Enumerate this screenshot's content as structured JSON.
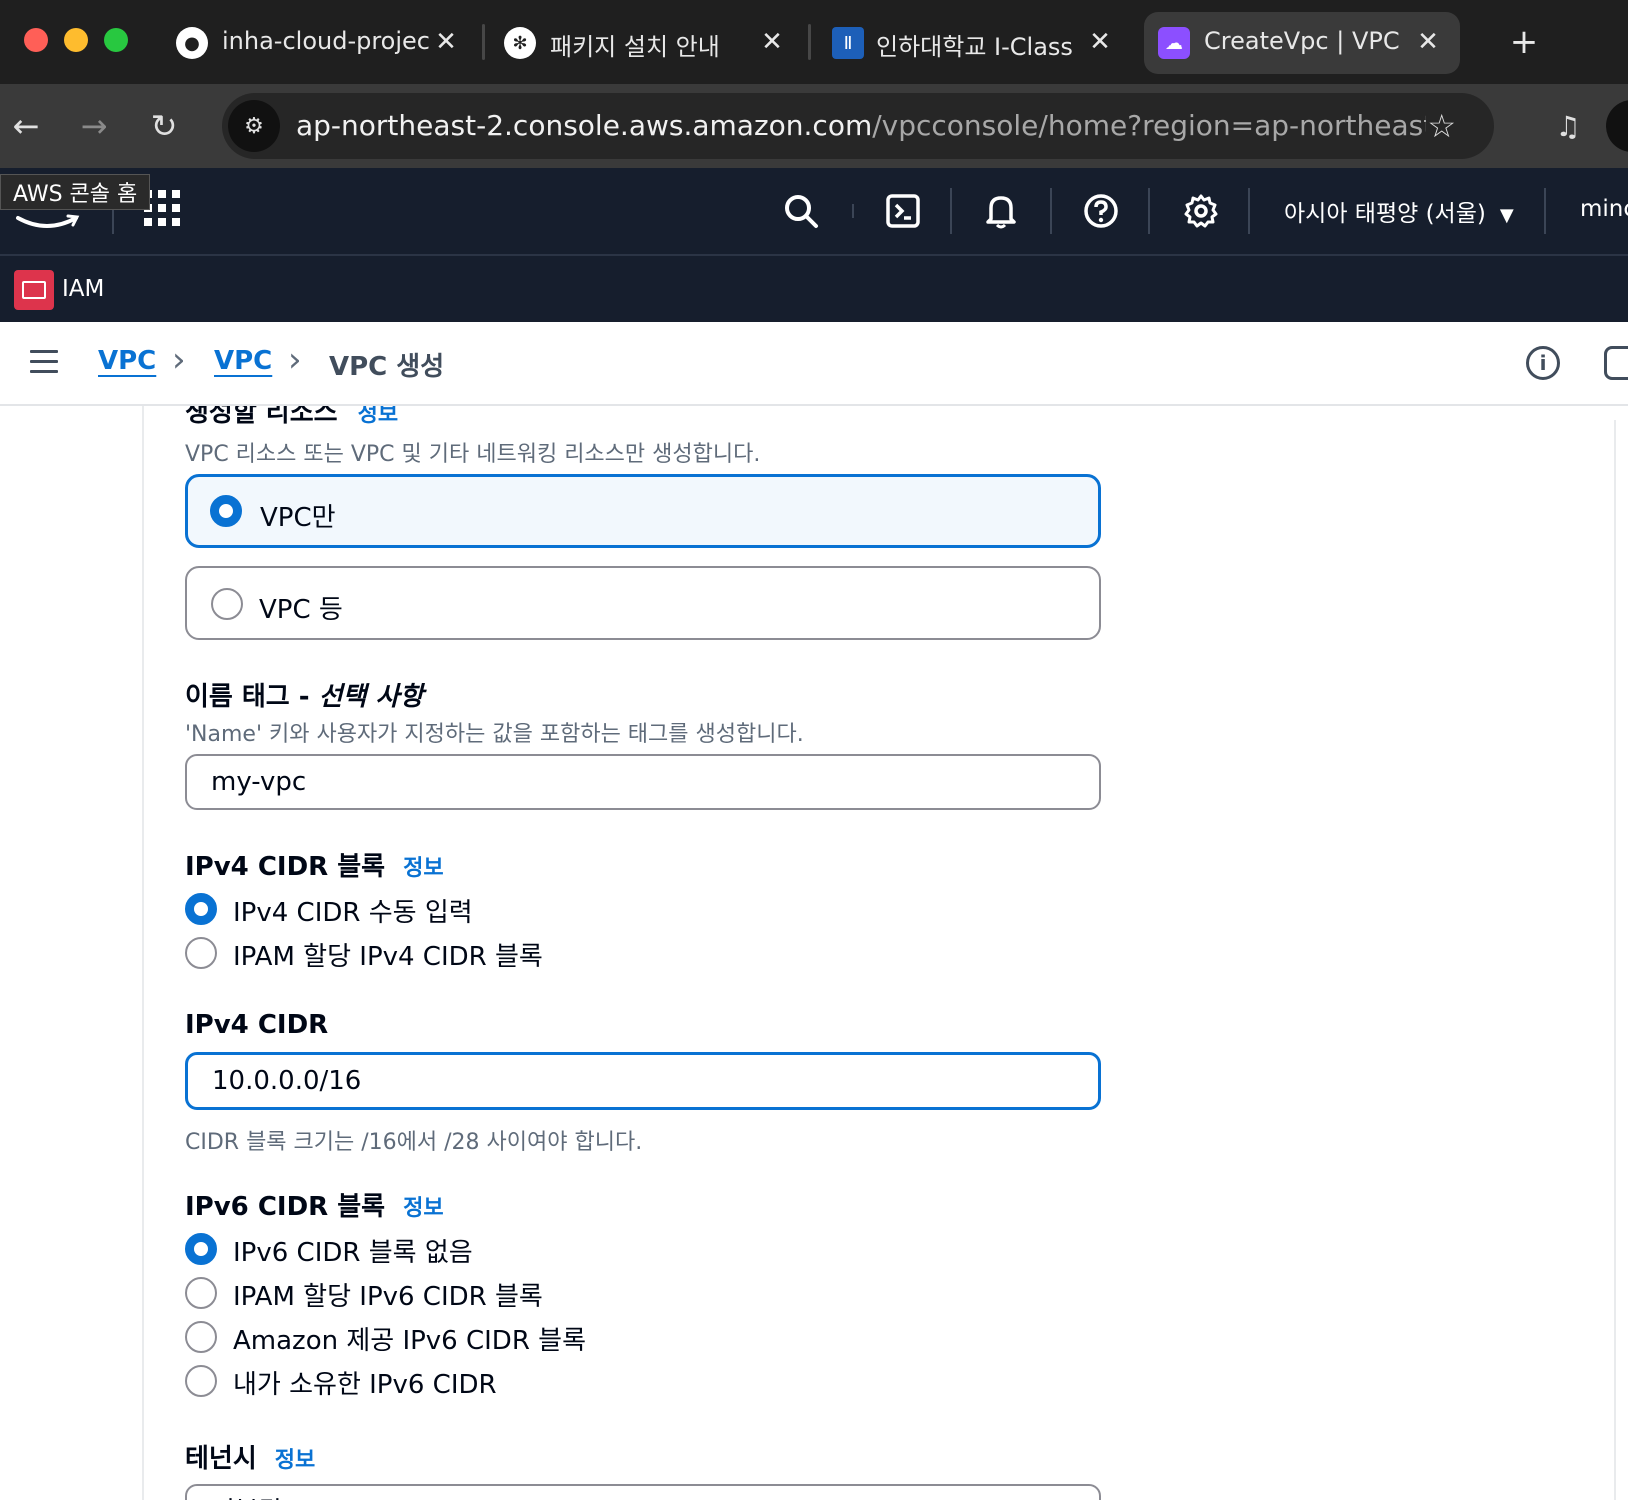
{
  "browser": {
    "tabs": [
      {
        "title": "inha-cloud-projec",
        "favicon": "github-icon"
      },
      {
        "title": "패키지 설치 안내",
        "favicon": "openai-icon"
      },
      {
        "title": "인하대학교 I-Class",
        "favicon": "iclass-icon"
      },
      {
        "title": "CreateVpc | VPC |",
        "favicon": "aws-vpc-icon",
        "active": true
      }
    ],
    "url_host": "ap-northeast-2.console.aws.amazon.com",
    "url_path": "/vpcconsole/home?region=ap-northeast-2..."
  },
  "aws_header": {
    "tooltip": "AWS 콘솔 홈",
    "region": "아시아 태평양 (서울)",
    "user": "minc",
    "service": "IAM"
  },
  "breadcrumb": {
    "items": [
      "VPC",
      "VPC"
    ],
    "current": "VPC 생성"
  },
  "form": {
    "resources_section": {
      "clipped_title": "생성할 리소스",
      "info_link": "정보",
      "description": "VPC 리소스 또는 VPC 및 기타 네트워킹 리소스만 생성합니다.",
      "options": [
        {
          "label": "VPC만",
          "selected": true
        },
        {
          "label": "VPC 등",
          "selected": false
        }
      ]
    },
    "name_tag": {
      "label": "이름 태그 - ",
      "label_optional": "선택 사항",
      "description": "'Name' 키와 사용자가 지정하는 값을 포함하는 태그를 생성합니다.",
      "value": "my-vpc"
    },
    "ipv4_block": {
      "label": "IPv4 CIDR 블록",
      "info_link": "정보",
      "options": [
        {
          "label": "IPv4 CIDR 수동 입력",
          "selected": true
        },
        {
          "label": "IPAM 할당 IPv4 CIDR 블록",
          "selected": false
        }
      ]
    },
    "ipv4_cidr": {
      "label": "IPv4 CIDR",
      "value": "10.0.0.0/16",
      "hint": "CIDR 블록 크기는 /16에서 /28 사이여야 합니다."
    },
    "ipv6_block": {
      "label": "IPv6 CIDR 블록",
      "info_link": "정보",
      "options": [
        {
          "label": "IPv6 CIDR 블록 없음",
          "selected": true
        },
        {
          "label": "IPAM 할당 IPv6 CIDR 블록",
          "selected": false
        },
        {
          "label": "Amazon 제공 IPv6 CIDR 블록",
          "selected": false
        },
        {
          "label": "내가 소유한 IPv6 CIDR",
          "selected": false
        }
      ]
    },
    "tenancy": {
      "label": "테넌시",
      "info_link": "정보",
      "value": "기본값"
    }
  },
  "colors": {
    "accent": "#0972d3",
    "aws_header_bg": "#161e2d",
    "selected_tile_bg": "#f2f8fd",
    "iam_icon": "#dd344c"
  }
}
